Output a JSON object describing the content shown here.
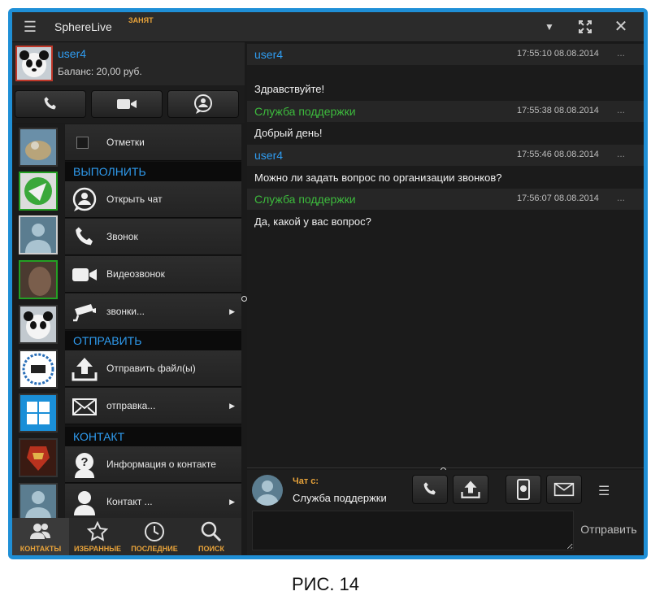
{
  "titlebar": {
    "app_name": "SphereLive",
    "status": "ЗАНЯТ",
    "menu_icon": "hamburger-icon",
    "dropdown_icon": "triangle-down-icon",
    "fullscreen_icon": "fullscreen-icon",
    "close_icon": "close-icon"
  },
  "profile": {
    "name": "user4",
    "balance": "Баланс: 20,00 руб."
  },
  "actions": [
    "phone-icon",
    "video-camera-icon",
    "chat-bubble-icon"
  ],
  "menu": {
    "checkbox_label": "Отметки",
    "section_execute": "ВЫПОЛНИТЬ",
    "open_chat": "Открыть чат",
    "call": "Звонок",
    "video_call": "Видеозвонок",
    "calls_more": "звонки...",
    "section_send": "ОТПРАВИТЬ",
    "send_file": "Отправить файл(ы)",
    "send_more": "отправка...",
    "section_contact": "КОНТАКТ",
    "contact_info": "Информация о контакте",
    "contact_more": "Контакт ...",
    "arrow": "▶"
  },
  "tabs": [
    {
      "label": "КОНТАКТЫ",
      "active": true
    },
    {
      "label": "ИЗБРАННЫЕ",
      "active": false
    },
    {
      "label": "ПОСЛЕДНИЕ",
      "active": false
    },
    {
      "label": "ПОИСК",
      "active": false
    }
  ],
  "messages": [
    {
      "author": "user4",
      "time": "17:55:10  08.08.2014",
      "text": "Здравствуйте!",
      "color": "#2f9cf0"
    },
    {
      "author": "Служба поддержки",
      "time": "17:55:38  08.08.2014",
      "text": "Добрый день!",
      "color": "#3dbb3d"
    },
    {
      "author": "user4",
      "time": "17:55:46  08.08.2014",
      "text": "Можно ли задать вопрос по организации звонков?",
      "color": "#2f9cf0"
    },
    {
      "author": "Служба поддержки",
      "time": "17:56:07  08.08.2014",
      "text": "Да,  какой у вас вопрос?",
      "color": "#3dbb3d"
    }
  ],
  "dots": "...",
  "composer": {
    "label": "Чат с:",
    "recipient": "Служба поддержки",
    "send": "Отправить",
    "input_value": ""
  },
  "caption": "РИС. 14",
  "colors": {
    "accent_blue": "#2f9cf0",
    "accent_green": "#3dbb3d",
    "status_orange": "#e8a33a",
    "frame_blue": "#1f8fd6"
  }
}
